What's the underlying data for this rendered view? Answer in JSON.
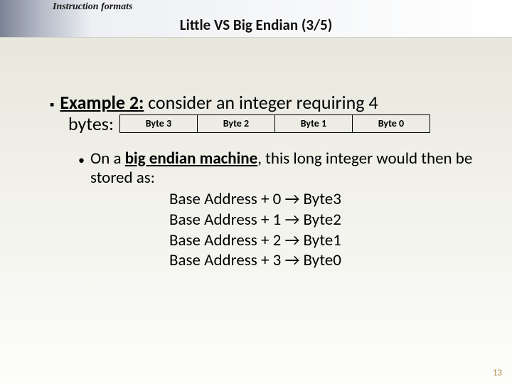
{
  "header": {
    "topic": "Instruction formats",
    "title": "Little VS Big Endian (3/5)"
  },
  "example": {
    "label": "Example 2:",
    "line1_rest": " consider an integer requiring 4",
    "line2_prefix": "bytes:",
    "bytes": [
      "Byte 3",
      "Byte 2",
      "Byte 1",
      "Byte 0"
    ]
  },
  "sub": {
    "pre": "On a ",
    "emph": "big endian machine",
    "post": ", this long integer would then be stored as:"
  },
  "addr_lines": [
    "Base Address + 0 → Byte3",
    "Base Address + 1 → Byte2",
    "Base Address + 2 → Byte1",
    "Base Address + 3 → Byte0"
  ],
  "page_number": "13"
}
